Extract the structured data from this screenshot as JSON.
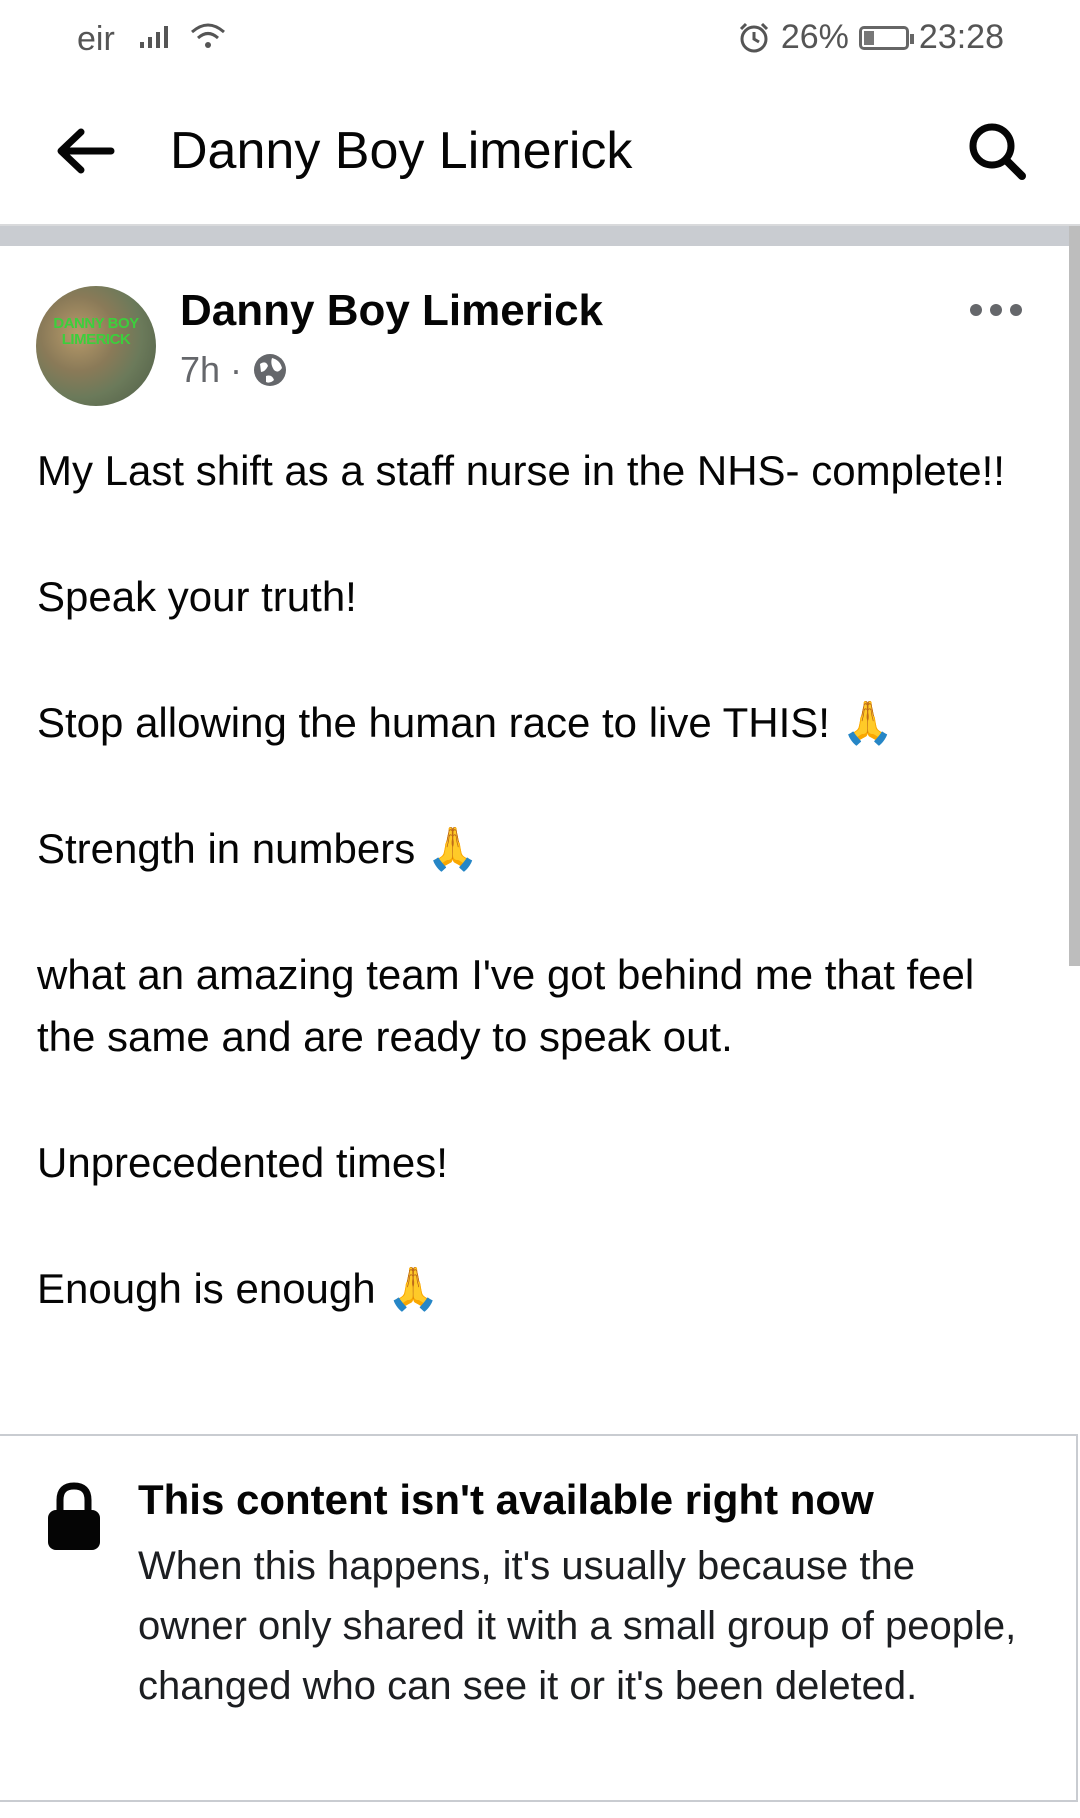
{
  "status_bar": {
    "carrier": "eir",
    "battery_percent": "26%",
    "battery_level": 0.26,
    "time": "23:28",
    "icons": [
      "signal-icon",
      "wifi-icon",
      "alarm-icon",
      "battery-icon"
    ]
  },
  "app_bar": {
    "title": "Danny Boy Limerick",
    "back_icon": "arrow-left-icon",
    "search_icon": "search-icon"
  },
  "post": {
    "author": "Danny Boy Limerick",
    "avatar_text": "DANNY BOY LIMERICK",
    "time_ago": "7h",
    "separator": "·",
    "privacy_icon": "globe-icon",
    "more_icon": "ellipsis-icon",
    "paragraphs": [
      "My Last shift as a staff nurse in the NHS- complete!!",
      "Speak your truth!",
      "Stop allowing the human race to live THIS! 🙏",
      "Strength in numbers 🙏",
      "what an amazing team I've got behind me that feel the same and are ready to speak out.",
      "Unprecedented times!",
      "Enough is enough 🙏"
    ]
  },
  "unavailable_notice": {
    "icon": "lock-icon",
    "title": "This content isn't available right now",
    "message": "When this happens, it's usually because the owner only shared it with a small group of people, changed who can see it or it's been deleted."
  },
  "colors": {
    "text_primary": "#050505",
    "text_secondary": "#65676b",
    "divider": "#c9ccd1",
    "background": "#ffffff"
  }
}
